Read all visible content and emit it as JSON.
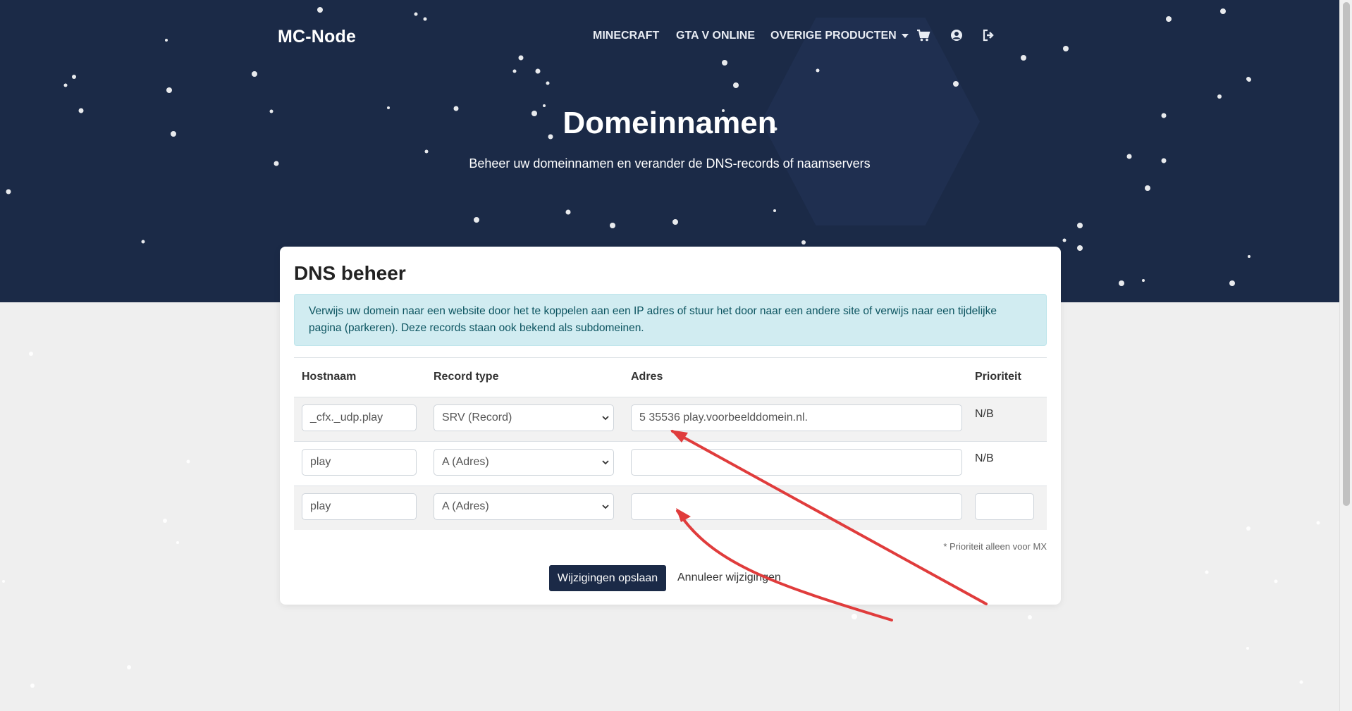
{
  "navbar": {
    "brand": "MC-Node",
    "items": [
      "MINECRAFT",
      "GTA V ONLINE",
      "OVERIGE PRODUCTEN"
    ],
    "icons": [
      "cart-icon",
      "user-circle-icon",
      "sign-out-icon"
    ]
  },
  "hero": {
    "title": "Domeinnamen",
    "subtitle": "Beheer uw domeinnamen en verander de DNS-records of naamservers"
  },
  "card": {
    "title": "DNS beheer",
    "alert": "Verwijs uw domein naar een website door het te koppelen aan een IP adres of stuur het door naar een andere site of verwijs naar een tijdelijke pagina (parkeren). Deze records staan ook bekend als subdomeinen."
  },
  "table": {
    "headers": [
      "Hostnaam",
      "Record type",
      "Adres",
      "Prioriteit"
    ],
    "rows": [
      {
        "hostname": "_cfx._udp.play",
        "record_type": "SRV (Record)",
        "address": "5 35536 play.voorbeelddomein.nl.",
        "priority": "N/B"
      },
      {
        "hostname": "play",
        "record_type": "A (Adres)",
        "address": "",
        "priority": "N/B"
      },
      {
        "hostname": "play",
        "record_type": "A (Adres)",
        "address": "",
        "priority": ""
      }
    ]
  },
  "note": "* Prioriteit alleen voor MX",
  "actions": {
    "save": "Wijzigingen opslaan",
    "cancel": "Annuleer wijzigingen"
  },
  "colors": {
    "hero_bg": "#1b2a47",
    "alert_bg": "#d1ecf1",
    "alert_text": "#0c5460",
    "annotation_arrow": "#e03c3c",
    "save_button": "#1b2a47"
  }
}
